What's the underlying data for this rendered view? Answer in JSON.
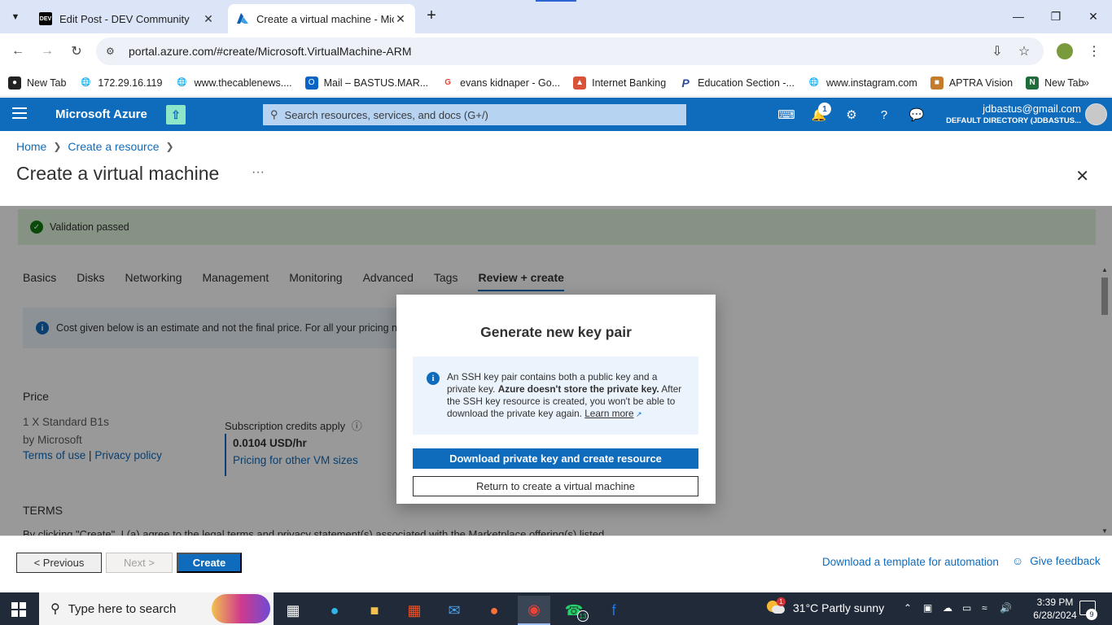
{
  "browser": {
    "tabs": [
      {
        "title": "Edit Post - DEV Community",
        "icon": "dev-logo-icon"
      },
      {
        "title": "Create a virtual machine - Microsoft Azure",
        "icon": "azure-logo-icon"
      }
    ],
    "url": "portal.azure.com/#create/Microsoft.VirtualMachine-ARM",
    "bookmarks": [
      {
        "label": "New Tab"
      },
      {
        "label": "172.29.16.119"
      },
      {
        "label": "www.thecablenews...."
      },
      {
        "label": "Mail – BASTUS.MAR..."
      },
      {
        "label": "evans kidnaper - Go..."
      },
      {
        "label": "Internet Banking"
      },
      {
        "label": "Education Section -..."
      },
      {
        "label": "www.instagram.com"
      },
      {
        "label": "APTRA Vision"
      },
      {
        "label": "New Tab"
      }
    ]
  },
  "azure": {
    "brand": "Microsoft Azure",
    "search_placeholder": "Search resources, services, and docs (G+/)",
    "notification_count": "1",
    "account_email": "jdbastus@gmail.com",
    "account_directory": "DEFAULT DIRECTORY (JDBASTUS..."
  },
  "page": {
    "breadcrumb": [
      "Home",
      "Create a resource"
    ],
    "title": "Create a virtual machine",
    "ellipsis": "···",
    "validation": "Validation passed",
    "tabs": [
      "Basics",
      "Disks",
      "Networking",
      "Management",
      "Monitoring",
      "Advanced",
      "Tags",
      "Review + create"
    ],
    "active_tab": "Review + create",
    "cost_notice": "Cost given below is an estimate and not the final price. For all your pricing needs",
    "price_label": "Price",
    "sku": "1 X Standard B1s",
    "publisher": "by Microsoft",
    "terms_of_use": "Terms of use",
    "divider": "|",
    "privacy_policy": "Privacy policy",
    "credits_label": "Subscription credits apply",
    "price_value": "0.0104 USD/hr",
    "pricing_link": "Pricing for other VM sizes",
    "terms_heading": "TERMS",
    "terms_text": "By clicking \"Create\", I (a) agree to the legal terms and privacy statement(s) associated with the Marketplace offering(s) listed"
  },
  "modal": {
    "title": "Generate new key pair",
    "info_part1": "An SSH key pair contains both a public key and a private key. ",
    "info_bold": "Azure doesn't store the private key.",
    "info_part2": " After the SSH key resource is created, you won't be able to download the private key again. ",
    "learn_more": "Learn more",
    "primary_button": "Download private key and create resource",
    "secondary_button": "Return to create a virtual machine"
  },
  "footer": {
    "previous": "< Previous",
    "next": "Next >",
    "create": "Create",
    "download_template": "Download a template for automation",
    "feedback": "Give feedback"
  },
  "taskbar": {
    "search_placeholder": "Type here to search",
    "whatsapp_badge": "13",
    "weather_badge": "1",
    "weather": "31°C  Partly sunny",
    "time": "3:39 PM",
    "date": "6/28/2024",
    "notifications": "9"
  }
}
